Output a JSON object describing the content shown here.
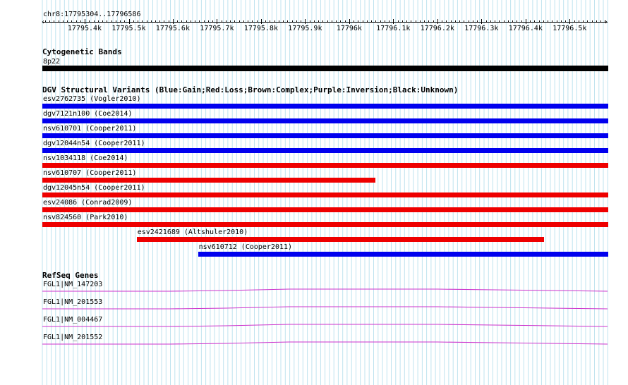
{
  "ruler": {
    "locus": "chr8:17795304..17796586",
    "start": 17795304,
    "end": 17796586,
    "ticks": [
      {
        "pos": 17795400,
        "label": "17795.4k"
      },
      {
        "pos": 17795500,
        "label": "17795.5k"
      },
      {
        "pos": 17795600,
        "label": "17795.6k"
      },
      {
        "pos": 17795700,
        "label": "17795.7k"
      },
      {
        "pos": 17795800,
        "label": "17795.8k"
      },
      {
        "pos": 17795900,
        "label": "17795.9k"
      },
      {
        "pos": 17796000,
        "label": "17796k"
      },
      {
        "pos": 17796100,
        "label": "17796.1k"
      },
      {
        "pos": 17796200,
        "label": "17796.2k"
      },
      {
        "pos": 17796300,
        "label": "17796.3k"
      },
      {
        "pos": 17796400,
        "label": "17796.4k"
      },
      {
        "pos": 17796500,
        "label": "17796.5k"
      }
    ]
  },
  "cytoband": {
    "title": "Cytogenetic Bands",
    "band_label": "8p22",
    "band_color": "#000000"
  },
  "dgv": {
    "title": "DGV Structural Variants (Blue:Gain;Red:Loss;Brown:Complex;Purple:Inversion;Black:Unknown)",
    "colors": {
      "gain": "#0000ee",
      "loss": "#ee0000"
    },
    "variants": [
      {
        "label": "esv2762735 (Vogler2010)",
        "type": "gain",
        "start": 17795304,
        "end": 17796586
      },
      {
        "label": "dgv7121n100 (Coe2014)",
        "type": "gain",
        "start": 17795304,
        "end": 17796586
      },
      {
        "label": "nsv610701 (Cooper2011)",
        "type": "gain",
        "start": 17795304,
        "end": 17796586
      },
      {
        "label": "dgv12044n54 (Cooper2011)",
        "type": "gain",
        "start": 17795304,
        "end": 17796586
      },
      {
        "label": "nsv1034118 (Coe2014)",
        "type": "loss",
        "start": 17795304,
        "end": 17796586
      },
      {
        "label": "nsv610707 (Cooper2011)",
        "type": "loss",
        "start": 17795304,
        "end": 17796057
      },
      {
        "label": "dgv12045n54 (Cooper2011)",
        "type": "loss",
        "start": 17795304,
        "end": 17796586
      },
      {
        "label": "esv24086 (Conrad2009)",
        "type": "loss",
        "start": 17795304,
        "end": 17796586
      },
      {
        "label": "nsv824560 (Park2010)",
        "type": "loss",
        "start": 17795304,
        "end": 17796586
      },
      {
        "label": "esv2421689 (Altshuler2010)",
        "type": "loss",
        "start": 17795518,
        "end": 17796441
      },
      {
        "label": "nsv610712 (Cooper2011)",
        "type": "gain",
        "start": 17795657,
        "end": 17796586
      }
    ]
  },
  "refseq": {
    "title": "RefSeq Genes",
    "line_color": "#cc33cc",
    "genes": [
      {
        "label": "FGL1|NM_147203"
      },
      {
        "label": "FGL1|NM_201553"
      },
      {
        "label": "FGL1|NM_004467"
      },
      {
        "label": "FGL1|NM_201552"
      }
    ]
  }
}
